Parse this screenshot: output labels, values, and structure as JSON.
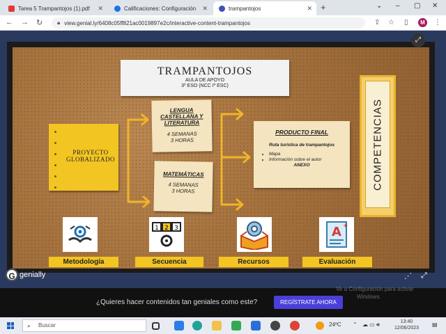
{
  "browser": {
    "tabs": [
      {
        "label": "Tarea 5 Trampantojos (1).pdf",
        "color": "#e53935"
      },
      {
        "label": "Calificaciones: Configuración",
        "color": "#1a73e8"
      },
      {
        "label": "trampantojos",
        "color": "#3f51b5"
      }
    ],
    "new_tab": "+",
    "url": "view.genial.ly/6408c05ff821ac0019897e2c/interactive-content-trampantojos",
    "profile_initial": "M",
    "window_controls": [
      "⌄",
      "–",
      "▢",
      "✕"
    ]
  },
  "genially": {
    "title": "TRAMPANTOJOS",
    "subtitle1": "AULA DE APOYO",
    "subtitle2": "3º ESO (NCC Iº ESC)",
    "proyecto": "PROYECTO GLOBALIZADO",
    "lengua": {
      "title": "LENGUA CASTELLANA Y LITERATURA",
      "line1": "4 SEMANAS",
      "line2": "3 HORAS"
    },
    "mates": {
      "title": "MATEMÁTICAS",
      "line1": "4 SEMANAS",
      "line2": "3 HORAS"
    },
    "producto": {
      "title": "PRODUCTO FINAL",
      "ruta": "Ruta turística de trampantojos",
      "items": [
        "Mapa",
        "Información sobre el autor"
      ],
      "anexo": "ANEXO"
    },
    "competencias": "COMPETENCIAS",
    "buttons": [
      "Metodología",
      "Secuencia",
      "Recursos",
      "Evaluación"
    ],
    "brand": "genially"
  },
  "promo": {
    "text": "¿Quieres hacer contenidos tan geniales como este?",
    "cta": "REGÍSTRATE AHORA"
  },
  "watermark": {
    "line1": "Ve a Configuración para activar",
    "line2": "Windows."
  },
  "taskbar": {
    "search_placeholder": "Buscar",
    "temperature": "24ºC",
    "time": "13:40",
    "date": "12/06/2023"
  }
}
